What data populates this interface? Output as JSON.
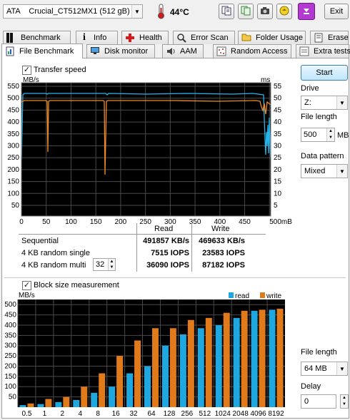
{
  "drive_selector": {
    "value": "ATA    Crucial_CT512MX1 (512 gB)"
  },
  "temperature": "44°C",
  "exit_label": "Exit",
  "tabs_row1": [
    "Benchmark",
    "Info",
    "Health",
    "Error Scan",
    "Folder Usage",
    "Erase"
  ],
  "tabs_row2": [
    "File Benchmark",
    "Disk monitor",
    "AAM",
    "Random Access",
    "Extra tests"
  ],
  "transfer_speed_label": "Transfer speed",
  "transfer_chart": {
    "left_unit": "MB/s",
    "right_unit": "ms",
    "y_ticks": [
      "550",
      "500",
      "450",
      "400",
      "350",
      "300",
      "250",
      "200",
      "150",
      "100",
      "50"
    ],
    "right_ticks": [
      "55",
      "50",
      "45",
      "40",
      "35",
      "30",
      "25",
      "20",
      "15",
      "10",
      "5"
    ],
    "x_ticks": [
      "0",
      "50",
      "100",
      "150",
      "200",
      "250",
      "300",
      "350",
      "400",
      "450",
      "500mB"
    ]
  },
  "results": {
    "col_read": "Read",
    "col_write": "Write",
    "rows": [
      {
        "label": "Sequential",
        "read": "491857 KB/s",
        "write": "469633 KB/s"
      },
      {
        "label": "4 KB random single",
        "read": "7515 IOPS",
        "write": "23583 IOPS"
      },
      {
        "label": "4 KB random multi",
        "read": "36090 IOPS",
        "write": "87182 IOPS"
      }
    ],
    "queue_depth": "32"
  },
  "block_size_label": "Block size measurement",
  "chart_data": {
    "type": "bar",
    "ylabel": "MB/s",
    "ylim": [
      0,
      500
    ],
    "y_ticks": [
      "500",
      "450",
      "400",
      "350",
      "300",
      "250",
      "200",
      "150",
      "100",
      "50"
    ],
    "categories": [
      "0.5",
      "1",
      "2",
      "4",
      "8",
      "16",
      "32",
      "64",
      "128",
      "256",
      "512",
      "1024",
      "2048",
      "4096",
      "8192"
    ],
    "series": [
      {
        "name": "read",
        "color": "#1fa8e0",
        "values": [
          10,
          15,
          25,
          35,
          70,
          100,
          165,
          200,
          300,
          355,
          385,
          400,
          435,
          470,
          475
        ]
      },
      {
        "name": "write",
        "color": "#e07a1a",
        "values": [
          18,
          40,
          50,
          100,
          165,
          250,
          325,
          385,
          385,
          425,
          435,
          460,
          470,
          475,
          480
        ]
      }
    ],
    "legend_placement": "top-right"
  },
  "sidebar": {
    "start_label": "Start",
    "drive_label": "Drive",
    "drive_value": "Z:",
    "file_length_label": "File length",
    "file_length_value": "500",
    "file_length_unit": "MB",
    "data_pattern_label": "Data pattern",
    "data_pattern_value": "Mixed",
    "block_file_length_label": "File length",
    "block_file_length_value": "64 MB",
    "delay_label": "Delay",
    "delay_value": "0"
  }
}
